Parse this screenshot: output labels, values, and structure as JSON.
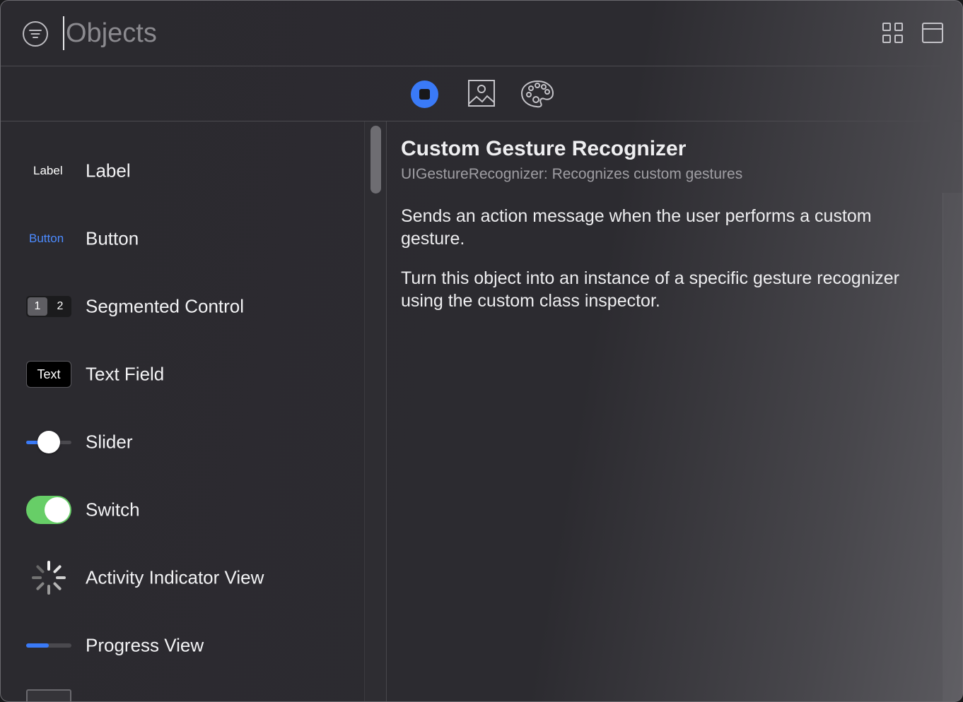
{
  "search": {
    "placeholder": "Objects",
    "value": ""
  },
  "tabs": [
    {
      "name": "objects",
      "selected": true
    },
    {
      "name": "media",
      "selected": false
    },
    {
      "name": "colors",
      "selected": false
    }
  ],
  "thumbs": {
    "label": "Label",
    "button": "Button",
    "segment_1": "1",
    "segment_2": "2",
    "text_field": "Text"
  },
  "objects": [
    {
      "label": "Label",
      "icon": "label-thumbnail"
    },
    {
      "label": "Button",
      "icon": "button-thumbnail"
    },
    {
      "label": "Segmented Control",
      "icon": "segmented-control-thumbnail"
    },
    {
      "label": "Text Field",
      "icon": "text-field-thumbnail"
    },
    {
      "label": "Slider",
      "icon": "slider-thumbnail"
    },
    {
      "label": "Switch",
      "icon": "switch-thumbnail"
    },
    {
      "label": "Activity Indicator View",
      "icon": "activity-indicator-icon"
    },
    {
      "label": "Progress View",
      "icon": "progress-view-thumbnail"
    }
  ],
  "controls": {
    "slider_value": 0.5,
    "switch_on": true,
    "progress_value": 0.5
  },
  "detail": {
    "title": "Custom Gesture Recognizer",
    "subtitle": "UIGestureRecognizer: Recognizes custom gestures",
    "paragraphs": [
      "Sends an action message when the user performs a custom gesture.",
      "Turn this object into an instance of a specific gesture recognizer using the custom class inspector."
    ]
  },
  "colors": {
    "accent": "#3a7af7",
    "switch_on": "#67ce67",
    "button_text": "#4c8bff"
  }
}
